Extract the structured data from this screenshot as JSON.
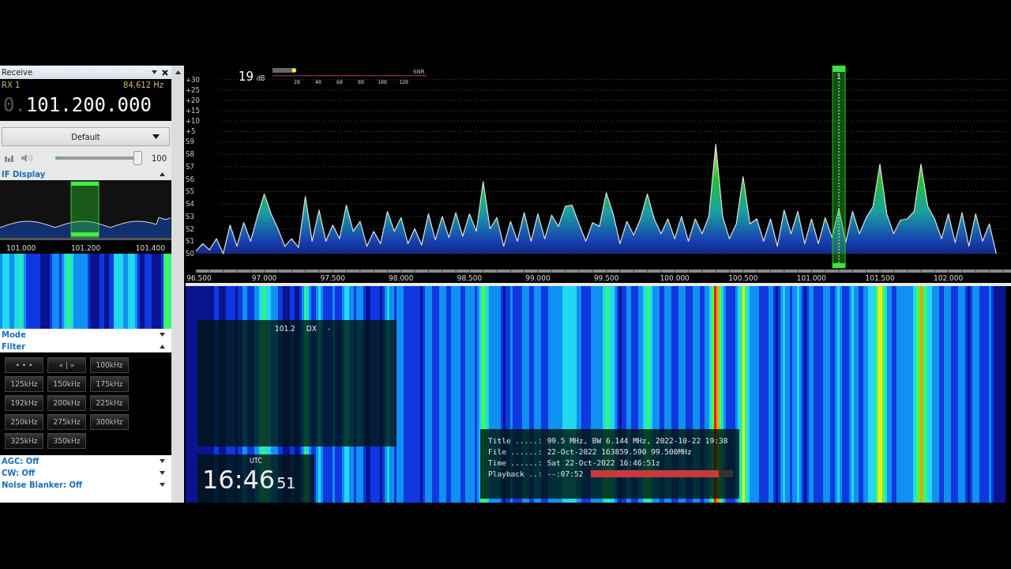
{
  "receive_panel": {
    "title": "Receive",
    "rx": "RX 1",
    "offset": "84,612 Hz",
    "frequency_prefix": "0.",
    "frequency": "101.200.000",
    "preset": "Default",
    "volume": {
      "level": 0.97,
      "reading": "100"
    },
    "if_display": {
      "title": "IF Display",
      "expanded": true,
      "axis": [
        "101.000",
        "101.200",
        "101.400"
      ]
    },
    "sections": [
      {
        "title": "Mode",
        "expanded": false
      },
      {
        "title": "Filter",
        "expanded": true
      }
    ],
    "filters": [
      "• • •",
      "« | »",
      "100kHz",
      "125kHz",
      "150kHz",
      "175kHz",
      "192kHz",
      "200kHz",
      "225kHz",
      "250kHz",
      "275kHz",
      "300kHz",
      "325kHz",
      "350kHz"
    ],
    "bottom_sections": [
      {
        "title": "AGC: Off",
        "expanded": false
      },
      {
        "title": "CW: Off",
        "expanded": false
      },
      {
        "title": "Noise Blanker: Off",
        "expanded": false
      }
    ]
  },
  "spectrum": {
    "snr_value": "19",
    "snr_unit": "dB",
    "snr_label": "SNR",
    "snr_meter": {
      "level": 0.14,
      "ticks": [
        "20",
        "40",
        "60",
        "80",
        "100",
        "120"
      ]
    },
    "vfo_label": "1",
    "chart_data": {
      "type": "area",
      "grid": true,
      "ref_lines": [
        {
          "axis": "x",
          "value": 101.2
        }
      ],
      "x": [
        96.5,
        96.55,
        96.6,
        96.65,
        96.7,
        96.75,
        96.8,
        96.85,
        96.9,
        96.95,
        97.0,
        97.05,
        97.1,
        97.15,
        97.2,
        97.25,
        97.3,
        97.35,
        97.4,
        97.45,
        97.5,
        97.55,
        97.6,
        97.65,
        97.7,
        97.75,
        97.8,
        97.85,
        97.9,
        97.95,
        98.0,
        98.05,
        98.1,
        98.15,
        98.2,
        98.25,
        98.3,
        98.35,
        98.4,
        98.45,
        98.5,
        98.55,
        98.6,
        98.65,
        98.7,
        98.75,
        98.8,
        98.85,
        98.9,
        98.95,
        99.0,
        99.05,
        99.1,
        99.15,
        99.2,
        99.25,
        99.3,
        99.35,
        99.4,
        99.45,
        99.5,
        99.55,
        99.6,
        99.65,
        99.7,
        99.75,
        99.8,
        99.85,
        99.9,
        99.95,
        100.0,
        100.05,
        100.1,
        100.15,
        100.2,
        100.25,
        100.3,
        100.35,
        100.4,
        100.45,
        100.5,
        100.55,
        100.6,
        100.65,
        100.7,
        100.75,
        100.8,
        100.85,
        100.9,
        100.95,
        101.0,
        101.05,
        101.1,
        101.15,
        101.2,
        101.25,
        101.3,
        101.35,
        101.4,
        101.45,
        101.5,
        101.55,
        101.6,
        101.65,
        101.7,
        101.75,
        101.8,
        101.85,
        101.9,
        101.95,
        102.0,
        102.05,
        102.1,
        102.15,
        102.2,
        102.25,
        102.3,
        102.35
      ],
      "series": [
        {
          "color": "#e0e0e0",
          "values": [
            -52.8,
            -49.2,
            -52.2,
            -46.8,
            -54,
            -40.2,
            -50.4,
            -39,
            -48,
            -36,
            -25.2,
            -34.8,
            -42,
            -50.4,
            -46.8,
            -51,
            -26.4,
            -48,
            -33,
            -48,
            -40.2,
            -46.8,
            -30.6,
            -43.2,
            -38.4,
            -50.4,
            -43.2,
            -49.2,
            -33.6,
            -43.2,
            -36.6,
            -49.2,
            -42,
            -49.8,
            -34.8,
            -47.4,
            -36,
            -46.2,
            -34.2,
            -45.6,
            -34.8,
            -43.2,
            -19.2,
            -42,
            -36.6,
            -50.4,
            -38.4,
            -48,
            -34.2,
            -48,
            -34.8,
            -46.8,
            -35.4,
            -40.8,
            -31.2,
            -30.6,
            -39.6,
            -48,
            -39,
            -40.8,
            -24.6,
            -34.8,
            -49.2,
            -38.4,
            -45,
            -37.2,
            -25.2,
            -37.2,
            -44.4,
            -37.2,
            -46.8,
            -36,
            -48,
            -37.2,
            -44.4,
            -36,
            -1.2,
            -36,
            -46.8,
            -39.6,
            -16.8,
            -39.6,
            -37.2,
            -48,
            -37.2,
            -50.4,
            -33,
            -44.4,
            -33.6,
            -49.2,
            -37.2,
            -49.2,
            -36.6,
            -46.2,
            -32.4,
            -48.6,
            -33.6,
            -44.4,
            -36.6,
            -31.2,
            -10.8,
            -34.8,
            -44.4,
            -37.8,
            -37.2,
            -33.6,
            -10.8,
            -31.2,
            -37.2,
            -46.8,
            -34.8,
            -48.6,
            -34.2,
            -50.4,
            -34.8,
            -48,
            -39.6,
            -54
          ]
        }
      ],
      "xlim": [
        96.5,
        102.458
      ],
      "ylim": [
        -54,
        30
      ],
      "xticks": [
        {
          "value": 96.5,
          "label": "96.500"
        },
        {
          "value": 97.0,
          "label": "97.000"
        },
        {
          "value": 97.5,
          "label": "97.500"
        },
        {
          "value": 98.0,
          "label": "98.000"
        },
        {
          "value": 98.5,
          "label": "98.500"
        },
        {
          "value": 99.0,
          "label": "99.000"
        },
        {
          "value": 99.5,
          "label": "99.500"
        },
        {
          "value": 100.0,
          "label": "100.000"
        },
        {
          "value": 100.5,
          "label": "100.500"
        },
        {
          "value": 101.0,
          "label": "101.000"
        },
        {
          "value": 101.5,
          "label": "101.500"
        },
        {
          "value": 102.0,
          "label": "102.000"
        }
      ],
      "yticks": [
        {
          "value": 30,
          "label": "+30"
        },
        {
          "value": 25,
          "label": "+25"
        },
        {
          "value": 20,
          "label": "+20"
        },
        {
          "value": 15,
          "label": "+15"
        },
        {
          "value": 10,
          "label": "+10"
        },
        {
          "value": 5,
          "label": "+5"
        },
        {
          "value": 0,
          "label": "S9"
        },
        {
          "value": -6,
          "label": "S8"
        },
        {
          "value": -12,
          "label": "S7"
        },
        {
          "value": -18,
          "label": "S6"
        },
        {
          "value": -24,
          "label": "S5"
        },
        {
          "value": -30,
          "label": "S4"
        },
        {
          "value": -36,
          "label": "S3"
        },
        {
          "value": -42,
          "label": "S2"
        },
        {
          "value": -48,
          "label": "S1"
        },
        {
          "value": -54,
          "label": "S0"
        }
      ]
    }
  },
  "waterfall": {
    "station": {
      "frequency": "101.2",
      "mode": "DX",
      "extra": "-"
    },
    "clock": {
      "label": "UTC",
      "hours_minutes": "16:46",
      "seconds": "51"
    },
    "info": [
      {
        "key": "Title .....:",
        "value": "99.5 MHz, BW 6.144 MHz, 2022-10-22 19:38"
      },
      {
        "key": "File ......:",
        "value": "22-Oct-2022 163859.590 99.500MHz"
      },
      {
        "key": "Time ......:",
        "value": "Sat 22-Oct-2022 16:46:51z"
      }
    ],
    "playback": {
      "key": "Playback ..:",
      "time": "--:07:52",
      "level": 0.9
    }
  }
}
